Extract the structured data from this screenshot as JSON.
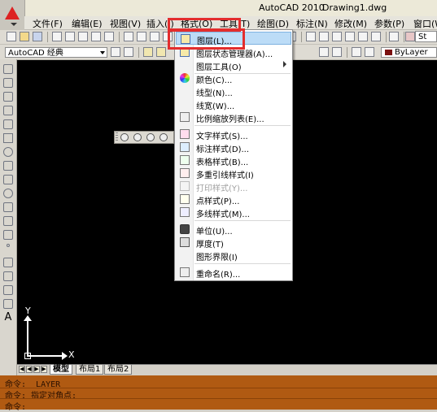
{
  "window": {
    "app_title": "AutoCAD 2010",
    "doc_title": "Drawing1.dwg"
  },
  "menubar": {
    "items": [
      {
        "label": "文件(F)"
      },
      {
        "label": "编辑(E)"
      },
      {
        "label": "视图(V)"
      },
      {
        "label": "插入(I)"
      },
      {
        "label": "格式(O)"
      },
      {
        "label": "工具(T)"
      },
      {
        "label": "绘图(D)"
      },
      {
        "label": "标注(N)"
      },
      {
        "label": "修改(M)"
      },
      {
        "label": "参数(P)"
      },
      {
        "label": "窗口(W)"
      }
    ]
  },
  "toolbar": {
    "workspace": "AutoCAD 经典",
    "text_style": "St",
    "color": "ByLayer",
    "color_swatch": "#7a1010"
  },
  "format_menu": {
    "items": [
      {
        "label": "图层(L)...",
        "icon": "layers-icon"
      },
      {
        "label": "图层状态管理器(A)...",
        "icon": "layer-state-icon"
      },
      {
        "label": "图层工具(O)",
        "icon": "",
        "submenu": true
      },
      {
        "label": "颜色(C)...",
        "icon": "color-wheel-icon"
      },
      {
        "label": "线型(N)...",
        "icon": ""
      },
      {
        "label": "线宽(W)...",
        "icon": ""
      },
      {
        "label": "比例缩放列表(E)...",
        "icon": "scale-list-icon"
      },
      {
        "label": "文字样式(S)...",
        "icon": "text-style-icon"
      },
      {
        "label": "标注样式(D)...",
        "icon": "dim-style-icon"
      },
      {
        "label": "表格样式(B)...",
        "icon": "table-style-icon"
      },
      {
        "label": "多重引线样式(I)",
        "icon": "mleader-style-icon"
      },
      {
        "label": "打印样式(Y)...",
        "icon": "plot-style-icon",
        "disabled": true
      },
      {
        "label": "点样式(P)...",
        "icon": "point-style-icon"
      },
      {
        "label": "多线样式(M)...",
        "icon": "mline-style-icon"
      },
      {
        "label": "单位(U)...",
        "icon": "units-icon"
      },
      {
        "label": "厚度(T)",
        "icon": "thickness-icon"
      },
      {
        "label": "图形界限(I)",
        "icon": ""
      },
      {
        "label": "重命名(R)...",
        "icon": "rename-icon"
      }
    ]
  },
  "ucs": {
    "x_label": "X",
    "y_label": "Y"
  },
  "layout_tabs": [
    {
      "label": "模型"
    },
    {
      "label": "布局1"
    },
    {
      "label": "布局2"
    }
  ],
  "command": {
    "line1": "命令:  LAYER",
    "line2": "命令: 指定对角点:",
    "line3": "命令:"
  },
  "colors": {
    "highlight_border": "#e32d2d",
    "command_bg": "#b05a12",
    "canvas_bg": "#000000"
  }
}
